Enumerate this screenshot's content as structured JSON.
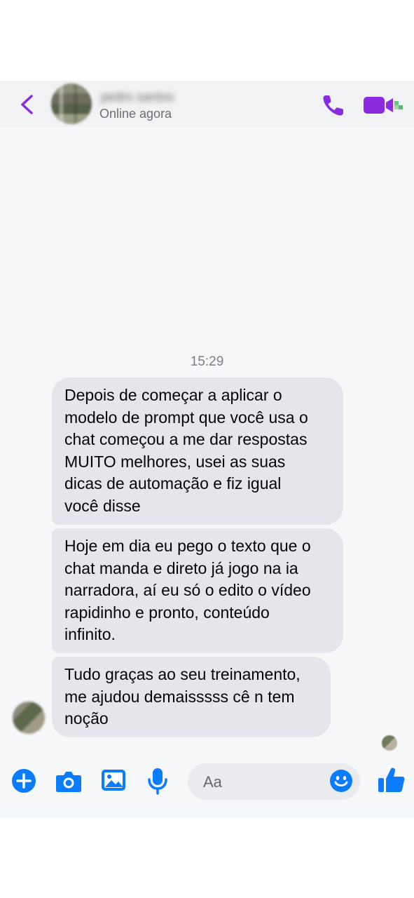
{
  "header": {
    "contact_name": "pedro santos",
    "status": "Online agora",
    "back_icon": "chevron-left-icon",
    "call_icon": "phone-icon",
    "video_icon": "video-camera-icon"
  },
  "conversation": {
    "timestamp": "15:29",
    "messages": [
      {
        "text": "Depois de começar a aplicar o\nmodelo de prompt que você usa o\nchat começou a me dar respostas\nMUITO melhores, usei as suas\ndicas de automação e fiz igual\nvocê disse"
      },
      {
        "text": "Hoje em dia eu pego o texto que o\nchat manda e direto já jogo na ia\nnarradora, aí eu só o edito o vídeo\nrapidinho e pronto, conteúdo\ninfinito."
      },
      {
        "text": "Tudo graças ao seu treinamento,\nme ajudou demaisssss cê n tem\nnoção"
      }
    ]
  },
  "composer": {
    "placeholder": "Aa",
    "icons": [
      "plus-icon",
      "camera-icon",
      "photo-icon",
      "microphone-icon",
      "emoji-icon",
      "thumbs-up-icon"
    ]
  },
  "colors": {
    "accent_purple": "#8a2be2",
    "composer_blue": "#0a7cff",
    "bubble_gray": "#e4e6eb"
  }
}
